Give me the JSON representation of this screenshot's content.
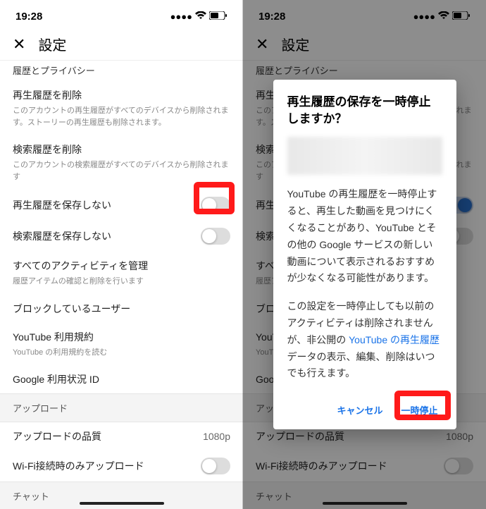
{
  "status": {
    "time": "19:28"
  },
  "header": {
    "title": "設定",
    "close": "✕"
  },
  "sections": {
    "history_privacy": "履歴とプライバシー",
    "delete_watch": {
      "title": "再生履歴を削除",
      "desc": "このアカウントの再生履歴がすべてのデバイスから削除されます。ストーリーの再生履歴も削除されます。"
    },
    "delete_search": {
      "title": "検索履歴を削除",
      "desc": "このアカウントの検索履歴がすべてのデバイスから削除されます"
    },
    "pause_watch": {
      "title": "再生履歴を保存しない"
    },
    "pause_search": {
      "title": "検索履歴を保存しない"
    },
    "manage_activity": {
      "title": "すべてのアクティビティを管理",
      "desc": "履歴アイテムの確認と削除を行います"
    },
    "blocked_users": {
      "title": "ブロックしているユーザー"
    },
    "youtube_terms": {
      "title": "YouTube 利用規約",
      "desc": "YouTube の利用規約を読む"
    },
    "google_id": {
      "title": "Google 利用状況 ID"
    },
    "upload": "アップロード",
    "upload_quality": {
      "title": "アップロードの品質",
      "value": "1080p"
    },
    "wifi_upload": {
      "title": "Wi-Fi接続時のみアップロード"
    },
    "chat": "チャット"
  },
  "dialog": {
    "title": "再生履歴の保存を一時停止しますか？",
    "body1_a": "YouTube の再生履歴を一時停止すると、再生した動画を見つけにくくなることがあり、YouTube とその他の Google サービスの新しい動画について表示されるおすすめが少なくなる可能性があります。",
    "body2_a": "この設定を一時停止しても以前のアクティビティは削除されませんが、非公開の ",
    "body2_link": "YouTube の再生履歴",
    "body2_b": "データの表示、編集、削除はいつでも行えます。",
    "cancel": "キャンセル",
    "confirm": "一時停止"
  }
}
